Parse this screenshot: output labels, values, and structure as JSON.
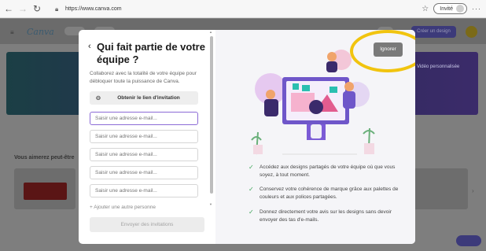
{
  "browser": {
    "url": "https://www.canva.com",
    "profile_label": "Invité"
  },
  "background_page": {
    "logo_text": "Canva",
    "create_button": "Créer un design",
    "banner_text": "Vidéo personnalisée",
    "section_title": "Vous aimerez peut-être"
  },
  "modal": {
    "title": "Qui fait partie de votre équipe ?",
    "subtitle": "Collaborez avec la totalité de votre équipe pour débloquer toute la puissance de Canva.",
    "invite_link_label": "Obtenir le lien d'invitation",
    "email_placeholders": [
      "Saisir une adresse e-mail...",
      "Saisir une adresse e-mail...",
      "Saisir une adresse e-mail...",
      "Saisir une adresse e-mail...",
      "Saisir une adresse e-mail..."
    ],
    "add_more_label": "+ Ajouter une autre personne",
    "send_button": "Envoyer des invitations",
    "ignore_button": "Ignorer",
    "benefits": [
      "Accédez aux designs partagés de votre équipe où que vous soyez, à tout moment.",
      "Conservez votre cohérence de marque grâce aux palettes de couleurs et aux polices partagées.",
      "Donnez directement votre avis sur les designs sans devoir envoyer des tas d'e-mails."
    ]
  },
  "colors": {
    "accent_ring": "#f1c40f",
    "check": "#3ea55a",
    "focus_border": "#8c6bd6",
    "illustration_purple": "#7b5bd6",
    "illustration_orange": "#f0a46b",
    "illustration_teal": "#2bbfb0"
  },
  "icons": [
    "back-arrow-icon",
    "forward-arrow-icon",
    "refresh-icon",
    "lock-icon",
    "favorites-icon",
    "link-icon",
    "check-icon",
    "chevron-left-icon"
  ]
}
